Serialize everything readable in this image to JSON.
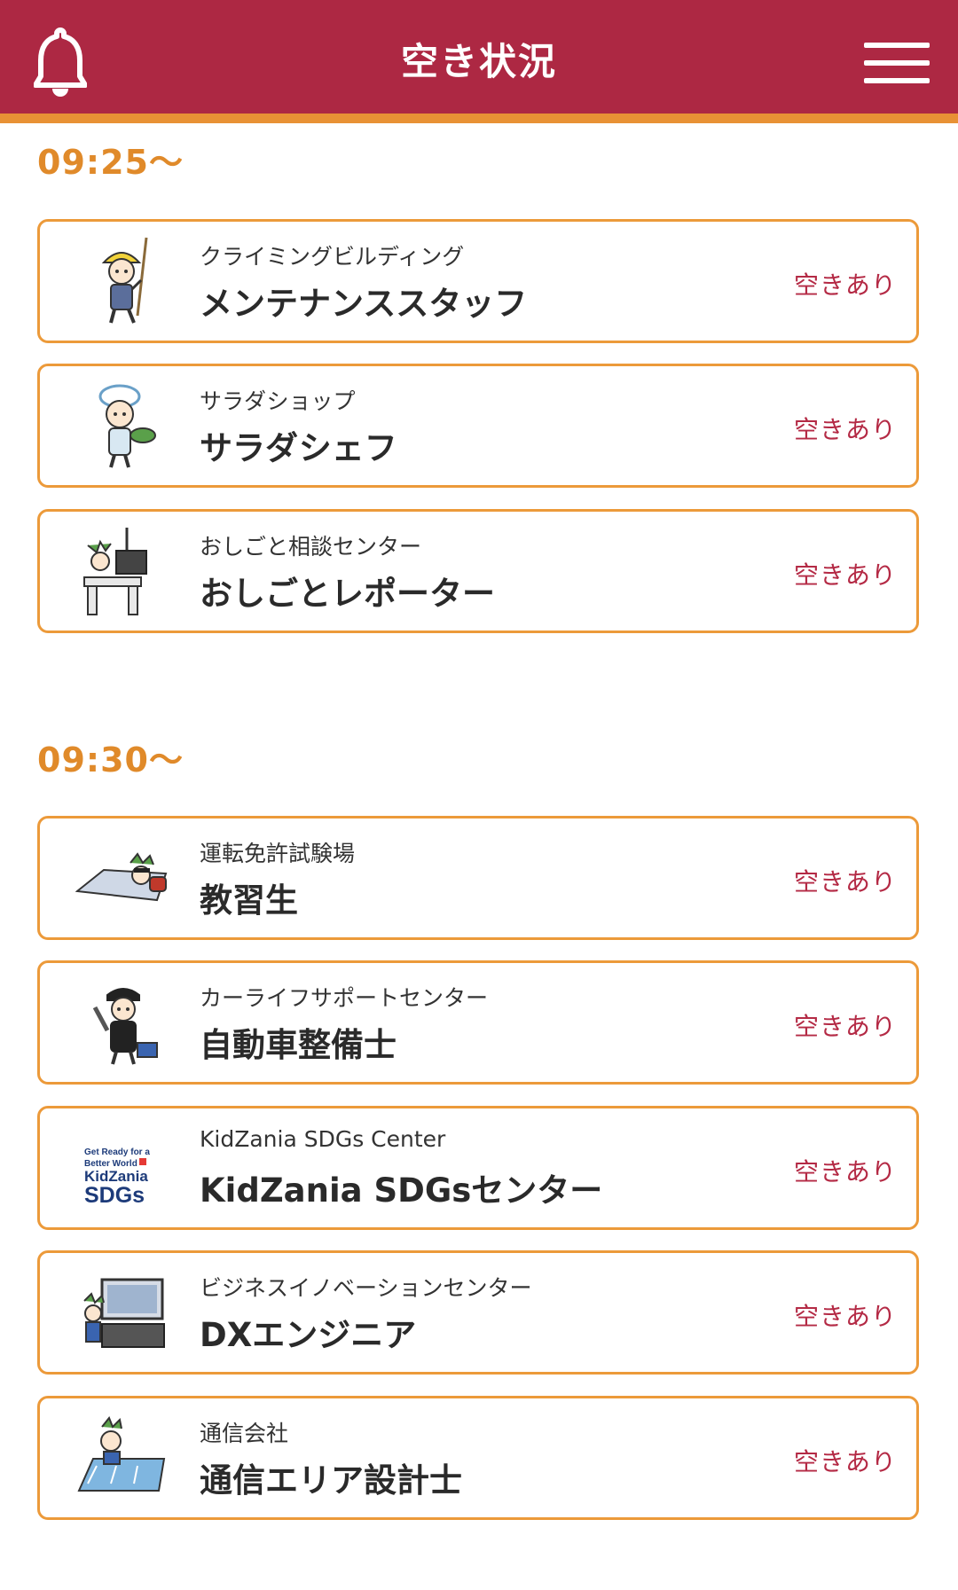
{
  "header": {
    "title": "空き状況",
    "bell_icon": "bell-icon",
    "menu_icon": "hamburger-menu-icon"
  },
  "colors": {
    "header_bg": "#ad2843",
    "accent_orange": "#e89135",
    "status_red": "#b42a45"
  },
  "sections": [
    {
      "time": "09:25〜",
      "items": [
        {
          "venue": "クライミングビルディング",
          "job": "メンテナンススタッフ",
          "status": "空きあり",
          "icon": "climber-mascot-icon"
        },
        {
          "venue": "サラダショップ",
          "job": "サラダシェフ",
          "status": "空きあり",
          "icon": "chef-mascot-icon"
        },
        {
          "venue": "おしごと相談センター",
          "job": "おしごとレポーター",
          "status": "空きあり",
          "icon": "reporter-desk-mascot-icon"
        }
      ]
    },
    {
      "time": "09:30〜",
      "items": [
        {
          "venue": "運転免許試験場",
          "job": "教習生",
          "status": "空きあり",
          "icon": "driving-mascot-icon"
        },
        {
          "venue": "カーライフサポートセンター",
          "job": "自動車整備士",
          "status": "空きあり",
          "icon": "mechanic-mascot-icon"
        },
        {
          "venue": "KidZania SDGs Center",
          "job": "KidZania SDGsセンター",
          "status": "空きあり",
          "icon": "kidzania-sdgs-logo",
          "logo_text": [
            "Get Ready for a",
            "Better World",
            "KidZania",
            "SDGs"
          ]
        },
        {
          "venue": "ビジネスイノベーションセンター",
          "job": "DXエンジニア",
          "status": "空きあり",
          "icon": "dx-engineer-mascot-icon"
        },
        {
          "venue": "通信会社",
          "job": "通信エリア設計士",
          "status": "空きあり",
          "icon": "map-designer-mascot-icon"
        }
      ]
    }
  ]
}
